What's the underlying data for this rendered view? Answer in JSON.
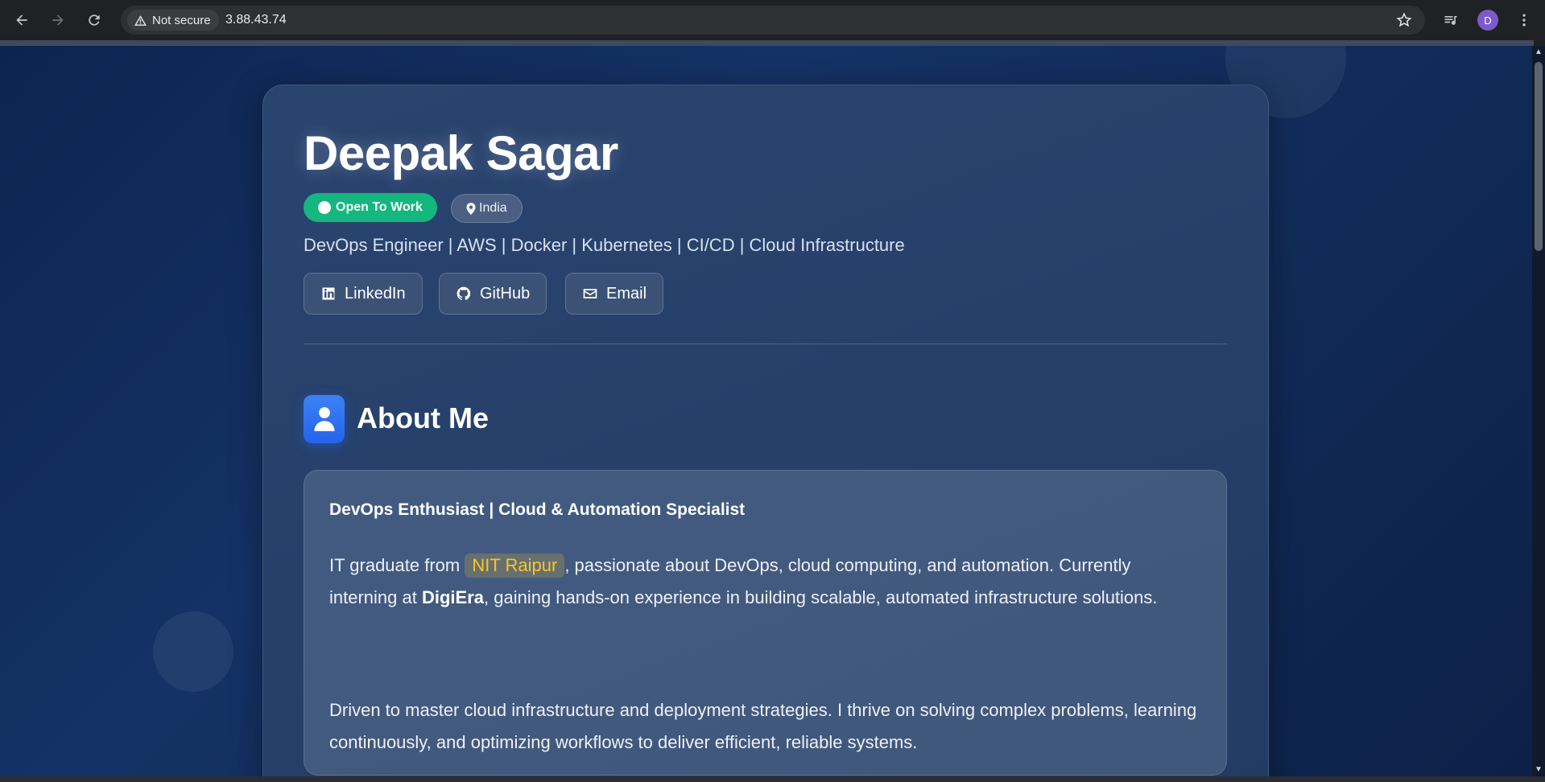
{
  "browser": {
    "security_label": "Not secure",
    "url": "3.88.43.74",
    "profile_initial": "D"
  },
  "profile": {
    "name": "Deepak Sagar",
    "status_badge": "Open To Work",
    "location": "India",
    "tagline": "DevOps Engineer | AWS | Docker | Kubernetes | CI/CD | Cloud Infrastructure",
    "links": {
      "linkedin": "LinkedIn",
      "github": "GitHub",
      "email": "Email"
    }
  },
  "about": {
    "title": "About Me",
    "heading": "DevOps Enthusiast | Cloud & Automation Specialist",
    "p1_before": "IT graduate from ",
    "p1_highlight": "NIT Raipur",
    "p1_middle": ", passionate about DevOps, cloud computing, and automation. Currently interning at ",
    "p1_bold": "DigiEra",
    "p1_after": ", gaining hands-on experience in building scalable, automated infrastructure solutions.",
    "p2": "Driven to master cloud infrastructure and deployment strategies. I thrive on solving complex problems, learning continuously, and optimizing workflows to deliver efficient, reliable systems."
  },
  "colors": {
    "accent_green": "#14b77d",
    "highlight_gold": "#f5c62d",
    "icon_blue": "#2563eb"
  }
}
